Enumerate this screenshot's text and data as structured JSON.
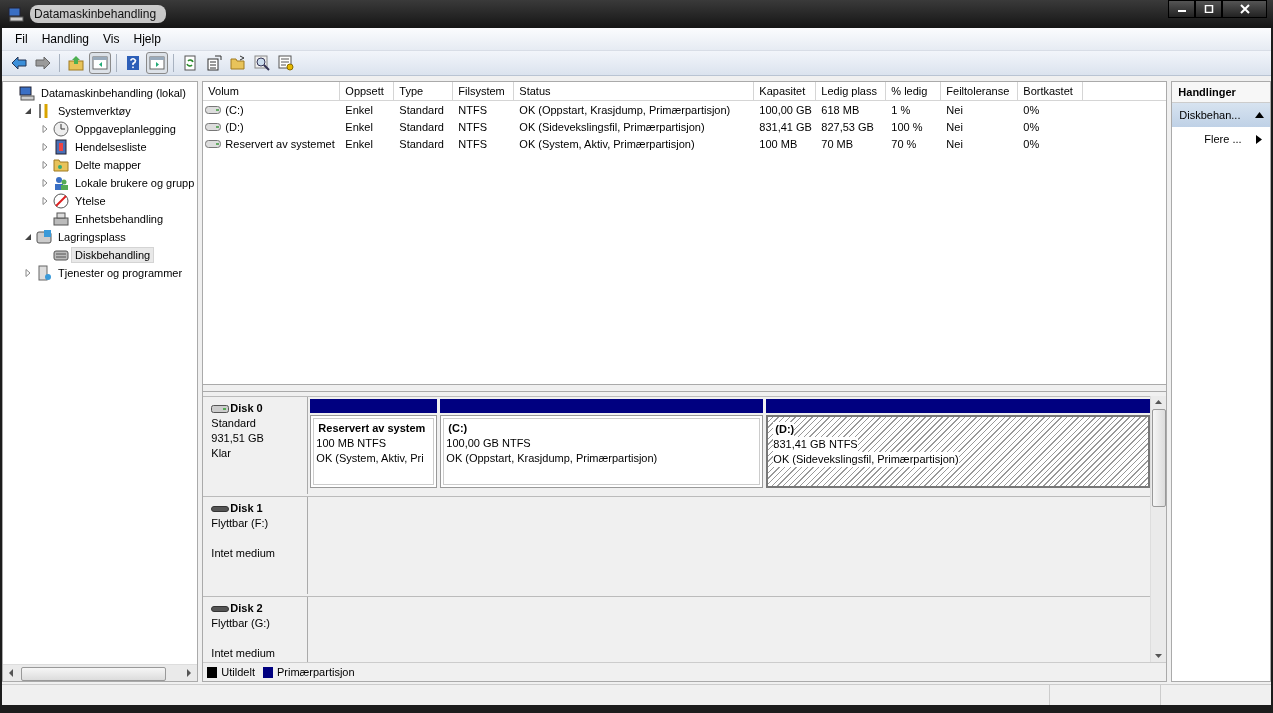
{
  "window": {
    "title": "Datamaskinbehandling"
  },
  "menu": [
    "Fil",
    "Handling",
    "Vis",
    "Hjelp"
  ],
  "toolbar": [
    {
      "kind": "back",
      "disabled": false
    },
    {
      "kind": "forward",
      "disabled": true
    },
    {
      "kind": "separator"
    },
    {
      "kind": "up-folder"
    },
    {
      "kind": "tree-toggle",
      "on": true
    },
    {
      "kind": "separator"
    },
    {
      "kind": "help"
    },
    {
      "kind": "pane-toggle",
      "on": true
    },
    {
      "kind": "separator"
    },
    {
      "kind": "refresh"
    },
    {
      "kind": "properties"
    },
    {
      "kind": "open"
    },
    {
      "kind": "find"
    },
    {
      "kind": "settings"
    }
  ],
  "tree": [
    {
      "label": "Datamaskinbehandling (lokal)",
      "selected": false,
      "children": [
        {
          "label": "Systemverktøy",
          "expanded": true,
          "selected": false,
          "children": [
            {
              "label": "Oppgaveplanlegging",
              "expanded": false,
              "selected": false
            },
            {
              "label": "Hendelsesliste",
              "expanded": false,
              "selected": false
            },
            {
              "label": "Delte mapper",
              "expanded": false,
              "selected": false
            },
            {
              "label": "Lokale brukere og grupp",
              "expanded": false,
              "selected": false
            },
            {
              "label": "Ytelse",
              "expanded": false,
              "selected": false
            },
            {
              "label": "Enhetsbehandling",
              "selected": false
            }
          ]
        },
        {
          "label": "Lagringsplass",
          "expanded": true,
          "selected": false,
          "children": [
            {
              "label": "Diskbehandling",
              "selected": true
            }
          ]
        },
        {
          "label": "Tjenester og programmer",
          "expanded": false,
          "selected": false
        }
      ]
    }
  ],
  "table": {
    "columns": [
      "Volum",
      "Oppsett",
      "Type",
      "Filsystem",
      "Status",
      "Kapasitet",
      "Ledig plass",
      "% ledig",
      "Feiltoleranse",
      "Bortkastet"
    ],
    "rows": [
      [
        "(C:)",
        "Enkel",
        "Standard",
        "NTFS",
        "OK (Oppstart, Krasjdump, Primærpartisjon)",
        "100,00 GB",
        "618 MB",
        "1 %",
        "Nei",
        "0%"
      ],
      [
        "(D:)",
        "Enkel",
        "Standard",
        "NTFS",
        "OK (Sidevekslingsfil, Primærpartisjon)",
        "831,41 GB",
        "827,53 GB",
        "100 %",
        "Nei",
        "0%"
      ],
      [
        "Reservert av systemet",
        "Enkel",
        "Standard",
        "NTFS",
        "OK (System, Aktiv, Primærpartisjon)",
        "100 MB",
        "70 MB",
        "70 %",
        "Nei",
        "0%"
      ]
    ]
  },
  "disks": [
    {
      "name": "Disk 0",
      "kind": "fixed",
      "type": "Standard",
      "size": "931,51 GB",
      "status": "Klar",
      "partitions": [
        {
          "title": "Reservert av system",
          "size": "100 MB NTFS",
          "status": "OK (System, Aktiv, Pri",
          "kind": "primary",
          "selected": false
        },
        {
          "title": "(C:)",
          "size": "100,00 GB NTFS",
          "status": "OK (Oppstart, Krasjdump, Primærpartisjon)",
          "kind": "primary",
          "selected": false
        },
        {
          "title": "(D:)",
          "size": "831,41 GB NTFS",
          "status": "OK (Sidevekslingsfil, Primærpartisjon)",
          "kind": "primary",
          "selected": true
        }
      ]
    },
    {
      "name": "Disk 1",
      "kind": "removable",
      "type": "Flyttbar (F:)",
      "status": "Intet medium"
    },
    {
      "name": "Disk 2",
      "kind": "removable",
      "type": "Flyttbar (G:)",
      "status": "Intet medium"
    }
  ],
  "legend": [
    {
      "label": "Utildelt",
      "color": "#000000"
    },
    {
      "label": "Primærpartisjon",
      "color": "#000080"
    }
  ],
  "actions": {
    "title": "Handlinger",
    "sections": [
      {
        "label": "Diskbehan...",
        "expanded": true,
        "items": [
          "Flere ..."
        ]
      }
    ]
  }
}
